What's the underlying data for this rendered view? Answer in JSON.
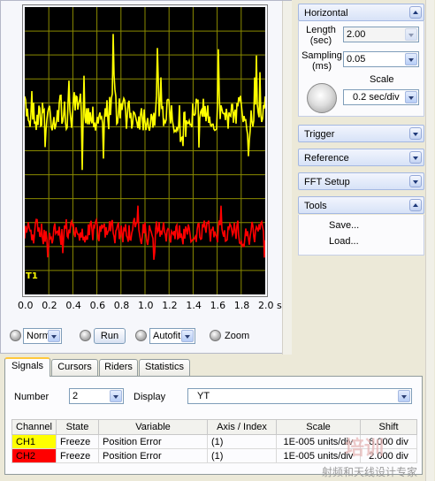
{
  "scope": {
    "trigger_marker": "T1",
    "x_ticks": [
      "0.0",
      "0.2",
      "0.4",
      "0.6",
      "0.8",
      "1.0",
      "1.2",
      "1.4",
      "1.6",
      "1.8",
      "2.0 s"
    ],
    "trace_colors": {
      "ch1": "#ffff00",
      "ch2": "#ff0000",
      "grid": "#8a8a00",
      "background": "#000000"
    }
  },
  "controls": {
    "mode_value": "Normal",
    "run_label": "Run",
    "autofit_value": "Autofit",
    "zoom_label": "Zoom"
  },
  "right_panel": {
    "horizontal": {
      "title": "Horizontal",
      "length_label_1": "Length",
      "length_label_2": "(sec)",
      "length_value": "2.00",
      "sampling_label_1": "Sampling",
      "sampling_label_2": "(ms)",
      "sampling_value": "0.05",
      "scale_label": "Scale",
      "scale_value": "0.2 sec/div"
    },
    "trigger_title": "Trigger",
    "reference_title": "Reference",
    "fft_title": "FFT Setup",
    "tools": {
      "title": "Tools",
      "items": [
        "Save...",
        "Load..."
      ]
    }
  },
  "tabs": [
    "Signals",
    "Cursors",
    "Riders",
    "Statistics"
  ],
  "signals": {
    "number_label": "Number",
    "number_value": "2",
    "display_label": "Display",
    "display_value": "YT",
    "columns": [
      "Channel",
      "State",
      "Variable",
      "Axis / Index",
      "Scale",
      "Shift"
    ],
    "rows": [
      {
        "channel": "CH1",
        "color": "#ffff00",
        "state": "Freeze",
        "variable": "Position Error",
        "axis": "(1)",
        "scale": "1E-005 units/div",
        "shift": "6.000 div"
      },
      {
        "channel": "CH2",
        "color": "#ff0000",
        "state": "Freeze",
        "variable": "Position Error",
        "axis": "(1)",
        "scale": "1E-005 units/div",
        "shift": "2.000 div"
      }
    ]
  },
  "watermark": "射频和天线设计专家"
}
